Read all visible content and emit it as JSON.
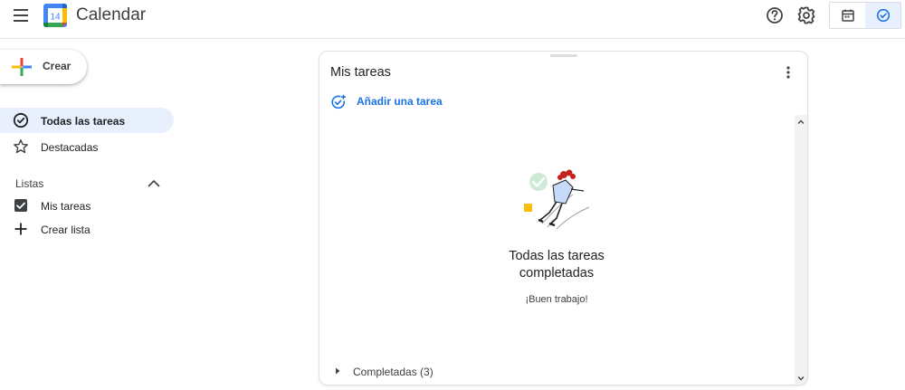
{
  "header": {
    "app_title": "Calendar",
    "logo_day": "14",
    "icons": [
      "menu-icon",
      "help-icon",
      "settings-icon",
      "calendar-view-icon",
      "tasks-view-icon"
    ]
  },
  "create_button": {
    "label": "Crear"
  },
  "sidebar": {
    "items": [
      {
        "label": "Todas las tareas",
        "icon": "check-circle-icon",
        "active": true
      },
      {
        "label": "Destacadas",
        "icon": "star-icon",
        "active": false
      }
    ],
    "lists_header": "Listas",
    "lists": [
      {
        "label": "Mis tareas",
        "icon": "checkbox-icon",
        "checked": true
      },
      {
        "label": "Crear lista",
        "icon": "plus-icon"
      }
    ]
  },
  "panel": {
    "title": "Mis tareas",
    "add_task_label": "Añadir una tarea",
    "empty_title_line1": "Todas las tareas",
    "empty_title_line2": "completadas",
    "empty_subtitle": "¡Buen trabajo!",
    "completed_label": "Completadas (3)"
  },
  "colors": {
    "accent": "#1a73e8",
    "active_bg": "#e8f0fe",
    "text": "#202124"
  }
}
